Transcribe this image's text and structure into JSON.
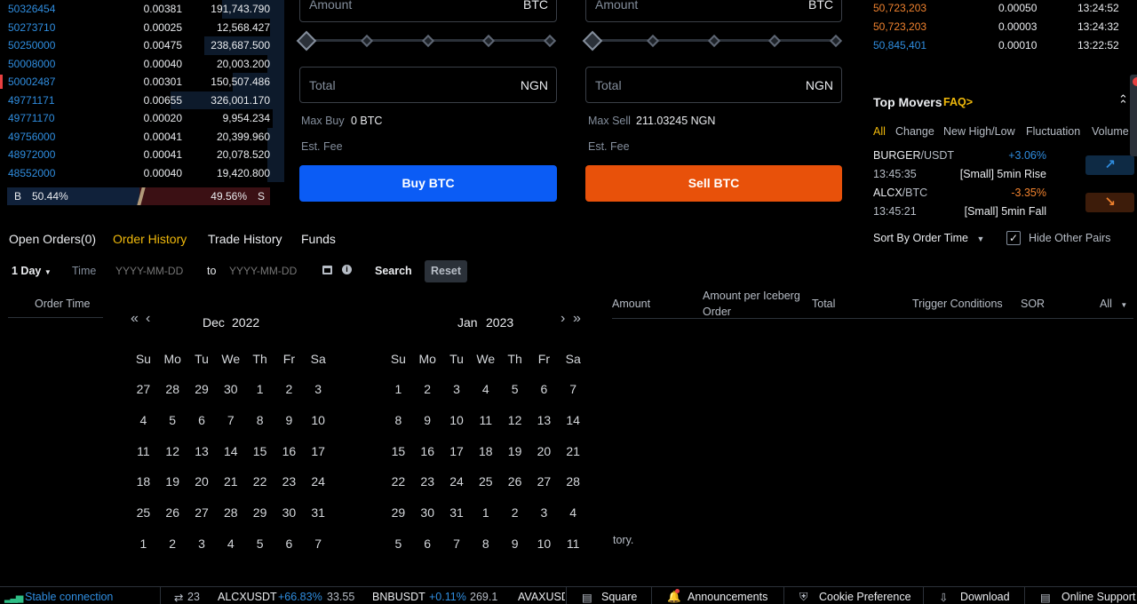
{
  "order_book": {
    "rows": [
      {
        "price": "50326454",
        "amount": "0.00381",
        "total": "191,743.790",
        "depth": 0.22
      },
      {
        "price": "50273710",
        "amount": "0.00025",
        "total": "12,568.427",
        "depth": 0.05
      },
      {
        "price": "50250000",
        "amount": "0.00475",
        "total": "238,687.500",
        "depth": 0.28
      },
      {
        "price": "50008000",
        "amount": "0.00040",
        "total": "20,003.200",
        "depth": 0.06
      },
      {
        "price": "50002487",
        "amount": "0.00301",
        "total": "150,507.486",
        "depth": 0.18
      },
      {
        "price": "49771171",
        "amount": "0.00655",
        "total": "326,001.170",
        "depth": 0.4
      },
      {
        "price": "49771170",
        "amount": "0.00020",
        "total": "9,954.234",
        "depth": 0.04
      },
      {
        "price": "49756000",
        "amount": "0.00041",
        "total": "20,399.960",
        "depth": 0.06
      },
      {
        "price": "48972000",
        "amount": "0.00041",
        "total": "20,078.520",
        "depth": 0.06
      },
      {
        "price": "48552000",
        "amount": "0.00040",
        "total": "19,420.800",
        "depth": 0.06
      }
    ],
    "ratio": {
      "b_label": "B",
      "b_pct": "50.44%",
      "s_pct": "49.56%",
      "s_label": "S",
      "buy_fraction": 0.5044
    }
  },
  "buy_form": {
    "amount_label": "Amount",
    "amount_unit": "BTC",
    "total_label": "Total",
    "total_unit": "NGN",
    "max_label": "Max Buy",
    "max_value": "0 BTC",
    "fee_label": "Est. Fee",
    "button": "Buy BTC"
  },
  "sell_form": {
    "amount_label": "Amount",
    "amount_unit": "BTC",
    "total_label": "Total",
    "total_unit": "NGN",
    "max_label": "Max Sell",
    "max_value": "211.03245 NGN",
    "fee_label": "Est. Fee",
    "button": "Sell BTC"
  },
  "trades": [
    {
      "price": "50,723,203",
      "amount": "0.00050",
      "time": "13:24:52",
      "color": "#f0822e"
    },
    {
      "price": "50,723,203",
      "amount": "0.00003",
      "time": "13:24:32",
      "color": "#f0822e"
    },
    {
      "price": "50,845,401",
      "amount": "0.00010",
      "time": "13:22:52",
      "color": "#2f8ddf"
    }
  ],
  "top_movers": {
    "title": "Top Movers",
    "faq": "FAQ>",
    "tabs": [
      "All",
      "Change",
      "New High/Low",
      "Fluctuation",
      "Volume"
    ],
    "items": [
      {
        "base": "BURGER",
        "quote": "/USDT",
        "change": "+3.06%",
        "time": "13:45:35",
        "desc": "[Small] 5min Rise",
        "up": true
      },
      {
        "base": "ALCX",
        "quote": "/BTC",
        "change": "-3.35%",
        "time": "13:45:21",
        "desc": "[Small] 5min Fall",
        "up": false
      }
    ],
    "sort_label": "Sort By Order Time",
    "hide_label": "Hide Other Pairs"
  },
  "orders_tabs": [
    "Open Orders(0)",
    "Order History",
    "Trade History",
    "Funds"
  ],
  "filters": {
    "period": "1 Day",
    "time_label": "Time",
    "from_placeholder": "YYYY-MM-DD",
    "to_label": "to",
    "to_placeholder": "YYYY-MM-DD",
    "search": "Search",
    "reset": "Reset"
  },
  "columns": {
    "order_time": "Order Time",
    "amount": "Amount",
    "iceberg_1": "Amount per Iceberg",
    "iceberg_2": "Order",
    "total": "Total",
    "trigger": "Trigger Conditions",
    "sor": "SOR",
    "all": "All"
  },
  "empty_text": "tory.",
  "calendar": {
    "weekdays": [
      "Su",
      "Mo",
      "Tu",
      "We",
      "Th",
      "Fr",
      "Sa"
    ],
    "left": {
      "month": "Dec",
      "year": "2022",
      "days": [
        "27",
        "28",
        "29",
        "30",
        "1",
        "2",
        "3",
        "4",
        "5",
        "6",
        "7",
        "8",
        "9",
        "10",
        "11",
        "12",
        "13",
        "14",
        "15",
        "16",
        "17",
        "18",
        "19",
        "20",
        "21",
        "22",
        "23",
        "24",
        "25",
        "26",
        "27",
        "28",
        "29",
        "30",
        "31",
        "1",
        "2",
        "3",
        "4",
        "5",
        "6",
        "7"
      ]
    },
    "right": {
      "month": "Jan",
      "year": "2023",
      "days": [
        "1",
        "2",
        "3",
        "4",
        "5",
        "6",
        "7",
        "8",
        "9",
        "10",
        "11",
        "12",
        "13",
        "14",
        "15",
        "16",
        "17",
        "18",
        "19",
        "20",
        "21",
        "22",
        "23",
        "24",
        "25",
        "26",
        "27",
        "28",
        "29",
        "30",
        "31",
        "1",
        "2",
        "3",
        "4",
        "5",
        "6",
        "7",
        "8",
        "9",
        "10",
        "11"
      ]
    }
  },
  "footer": {
    "connection": "Stable connection",
    "count": "23",
    "tickers": [
      {
        "symbol": "ALCXUSDT",
        "change": "+66.83%",
        "price": "33.55"
      },
      {
        "symbol": "BNBUSDT",
        "change": "+0.11%",
        "price": "269.1"
      },
      {
        "symbol": "AVAXUSD",
        "change": "",
        "price": ""
      }
    ],
    "links": [
      "Square",
      "Announcements",
      "Cookie Preference",
      "Download",
      "Online Support"
    ]
  },
  "colors": {
    "buy": "#0b5cf5",
    "sell": "#e8510a",
    "yellow": "#f0b90b",
    "up": "#2f8ddf",
    "down": "#f0822e"
  }
}
